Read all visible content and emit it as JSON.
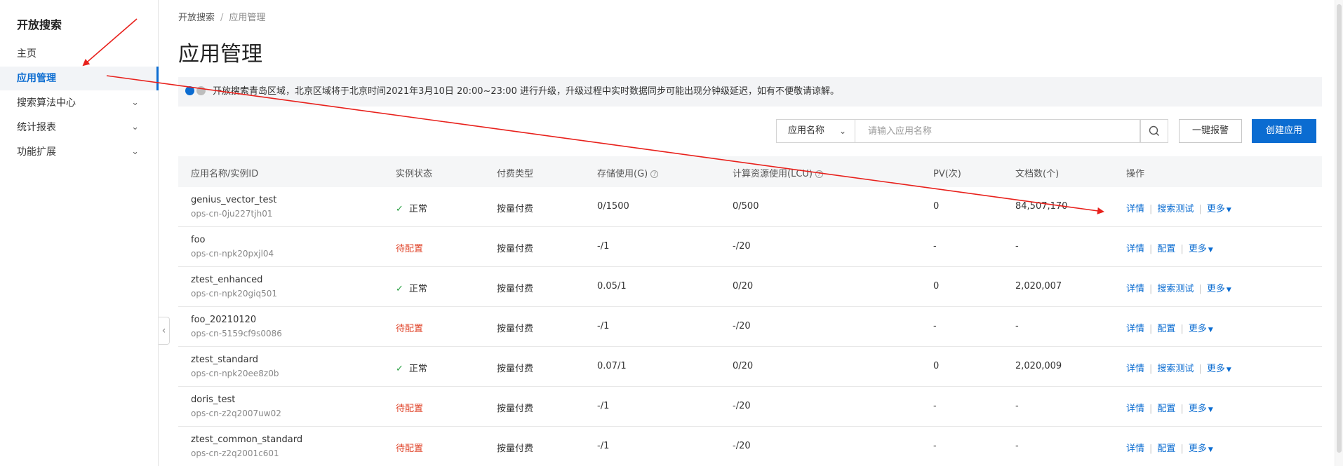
{
  "sidebar": {
    "brand": "开放搜索",
    "items": [
      {
        "label": "主页",
        "active": false,
        "expandable": false
      },
      {
        "label": "应用管理",
        "active": true,
        "expandable": false
      },
      {
        "label": "搜索算法中心",
        "active": false,
        "expandable": true
      },
      {
        "label": "统计报表",
        "active": false,
        "expandable": true
      },
      {
        "label": "功能扩展",
        "active": false,
        "expandable": true
      }
    ]
  },
  "breadcrumb": {
    "root": "开放搜索",
    "sep": "/",
    "current": "应用管理"
  },
  "page_title": "应用管理",
  "notice": "开放搜索青岛区域，北京区域将于北京时间2021年3月10日 20:00~23:00 进行升级，升级过程中实时数据同步可能出现分钟级延迟，如有不便敬请谅解。",
  "toolbar": {
    "select_value": "应用名称",
    "search_placeholder": "请输入应用名称",
    "alarm_label": "一键报警",
    "create_label": "创建应用"
  },
  "table": {
    "headers": {
      "name": "应用名称/实例ID",
      "status": "实例状态",
      "billing": "付费类型",
      "storage": "存储使用(G)",
      "compute": "计算资源使用(LCU)",
      "pv": "PV(次)",
      "docs": "文档数(个)",
      "actions": "操作"
    },
    "rows": [
      {
        "name": "genius_vector_test",
        "id": "ops-cn-0ju227tjh01",
        "status": "正常",
        "ok": true,
        "billing": "按量付费",
        "storage": "0/1500",
        "compute": "0/500",
        "pv": "0",
        "docs": "84,507,170",
        "actions": [
          "详情",
          "搜索测试",
          "更多"
        ]
      },
      {
        "name": "foo",
        "id": "ops-cn-npk20pxjl04",
        "status": "待配置",
        "ok": false,
        "billing": "按量付费",
        "storage": "-/1",
        "compute": "-/20",
        "pv": "-",
        "docs": "-",
        "actions": [
          "详情",
          "配置",
          "更多"
        ]
      },
      {
        "name": "ztest_enhanced",
        "id": "ops-cn-npk20giq501",
        "status": "正常",
        "ok": true,
        "billing": "按量付费",
        "storage": "0.05/1",
        "compute": "0/20",
        "pv": "0",
        "docs": "2,020,007",
        "actions": [
          "详情",
          "搜索测试",
          "更多"
        ]
      },
      {
        "name": "foo_20210120",
        "id": "ops-cn-5159cf9s0086",
        "status": "待配置",
        "ok": false,
        "billing": "按量付费",
        "storage": "-/1",
        "compute": "-/20",
        "pv": "-",
        "docs": "-",
        "actions": [
          "详情",
          "配置",
          "更多"
        ]
      },
      {
        "name": "ztest_standard",
        "id": "ops-cn-npk20ee8z0b",
        "status": "正常",
        "ok": true,
        "billing": "按量付费",
        "storage": "0.07/1",
        "compute": "0/20",
        "pv": "0",
        "docs": "2,020,009",
        "actions": [
          "详情",
          "搜索测试",
          "更多"
        ]
      },
      {
        "name": "doris_test",
        "id": "ops-cn-z2q2007uw02",
        "status": "待配置",
        "ok": false,
        "billing": "按量付费",
        "storage": "-/1",
        "compute": "-/20",
        "pv": "-",
        "docs": "-",
        "actions": [
          "详情",
          "配置",
          "更多"
        ]
      },
      {
        "name": "ztest_common_standard",
        "id": "ops-cn-z2q2001c601",
        "status": "待配置",
        "ok": false,
        "billing": "按量付费",
        "storage": "-/1",
        "compute": "-/20",
        "pv": "-",
        "docs": "-",
        "actions": [
          "详情",
          "配置",
          "更多"
        ]
      }
    ]
  },
  "colors": {
    "accent": "#0b6cd1",
    "ok": "#2ba245",
    "pending": "#e0452b",
    "annotation": "#e8211c"
  },
  "icons": {
    "search": "search-icon",
    "chevron": "chevron-down-icon",
    "collapse": "chevron-left-icon",
    "check": "check-icon"
  }
}
